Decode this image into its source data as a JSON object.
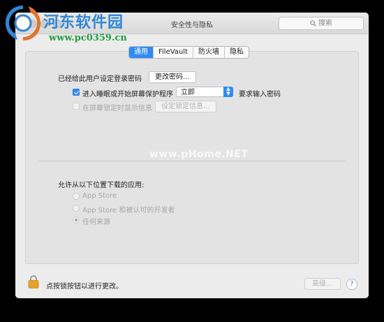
{
  "window": {
    "title": "安全性与隐私",
    "search_placeholder": "搜索"
  },
  "tabs": [
    {
      "label": "通用",
      "active": true
    },
    {
      "label": "FileVault",
      "active": false
    },
    {
      "label": "防火墙",
      "active": false
    },
    {
      "label": "隐私",
      "active": false
    }
  ],
  "general": {
    "password_set_text": "已经给此用户设定登录密码",
    "change_password_button": "更改密码...",
    "sleep_checkbox_label": "进入睡眠或开始屏幕保护程序",
    "sleep_checkbox_checked": true,
    "sleep_select_value": "立即",
    "require_password_text": "要求输入密码",
    "lock_message_checkbox_label": "在屏幕锁定时显示信息",
    "lock_message_checked": false,
    "set_lock_message_button": "设定锁定信息..."
  },
  "downloads": {
    "heading": "允许从以下位置下载的应用:",
    "options": [
      {
        "label": "App Store",
        "selected": false
      },
      {
        "label": "App Store 和被认可的开发者",
        "selected": false
      },
      {
        "label": "任何来源",
        "selected": true
      }
    ]
  },
  "footer": {
    "lock_text": "点按锁按钮以进行更改。",
    "advanced_button": "高级...",
    "help_button": "?"
  },
  "watermark": {
    "site_name": "河东软件园",
    "site_url": "www.pc0359.cn",
    "center_text": "www.pHome.NET"
  },
  "colors": {
    "accent": "#2f8cf5",
    "window_bg": "#ececec",
    "panel_bg": "#e3e3e3",
    "lock_icon": "#e6a22a",
    "watermark_blue": "#2f86d6",
    "watermark_green": "#1f9e3e"
  }
}
